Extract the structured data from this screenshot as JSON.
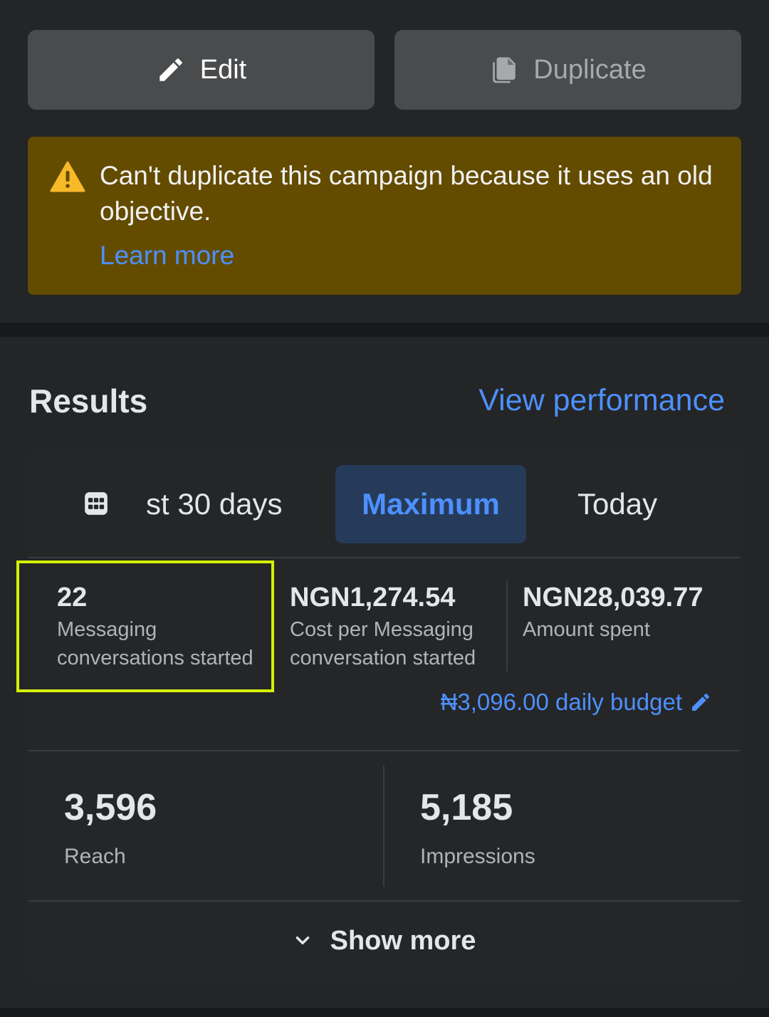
{
  "actions": {
    "edit_label": "Edit",
    "duplicate_label": "Duplicate",
    "edit_icon": "pencil-icon",
    "duplicate_icon": "copy-icon"
  },
  "warning": {
    "icon": "warning-triangle-icon",
    "message": "Can't duplicate this campaign because it uses an old objective.",
    "link": "Learn more"
  },
  "results": {
    "title": "Results",
    "view_performance": "View performance"
  },
  "date_tabs": {
    "calendar_icon": "calendar-icon",
    "items": [
      {
        "label": "st 30 days",
        "selected": false
      },
      {
        "label": "Maximum",
        "selected": true
      },
      {
        "label": "Today",
        "selected": false
      }
    ]
  },
  "metrics": [
    {
      "value": "22",
      "label": "Messaging conversations started"
    },
    {
      "value": "NGN1,274.54",
      "label": "Cost per Messaging conversation started"
    },
    {
      "value": "NGN28,039.77",
      "label": "Amount spent"
    }
  ],
  "budget": {
    "text": "₦3,096.00 daily budget",
    "icon": "pencil-icon"
  },
  "summary": [
    {
      "value": "3,596",
      "label": "Reach"
    },
    {
      "value": "5,185",
      "label": "Impressions"
    }
  ],
  "show_more": {
    "label": "Show more",
    "icon": "chevron-down-icon"
  },
  "colors": {
    "background": "#242526",
    "accent": "#4d90fe",
    "warning_bg": "#634c00",
    "highlight": "#d4f005"
  }
}
